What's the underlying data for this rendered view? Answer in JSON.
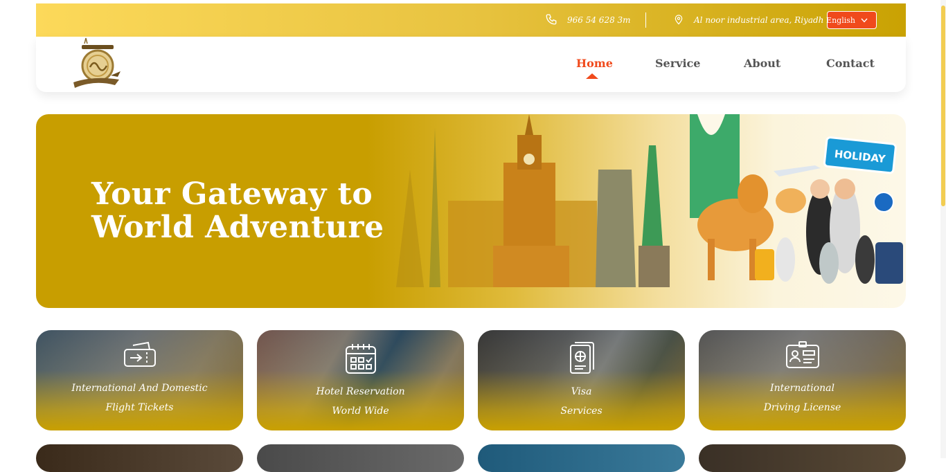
{
  "topbar": {
    "phone": "966 54 628 3m",
    "address": "Al noor industrial area, Riyadh",
    "language": "English"
  },
  "nav": {
    "items": [
      {
        "label": "Home",
        "active": true
      },
      {
        "label": "Service",
        "active": false
      },
      {
        "label": "About",
        "active": false
      },
      {
        "label": "Contact",
        "active": false
      }
    ]
  },
  "hero": {
    "title_line1": "Your Gateway to",
    "title_line2": "World Adventure",
    "sign_text": "HOLIDAY"
  },
  "services": [
    {
      "line1": "International And Domestic",
      "line2": "Flight Tickets",
      "icon": "ticket-icon"
    },
    {
      "line1": "Hotel Reservation",
      "line2": "World Wide",
      "icon": "calendar-icon"
    },
    {
      "line1": "Visa",
      "line2": "Services",
      "icon": "passport-icon"
    },
    {
      "line1": "International",
      "line2": "Driving License",
      "icon": "id-card-icon"
    }
  ],
  "colors": {
    "accent": "#f04a1c",
    "gold": "#c89e00",
    "topbar_light": "#fcd95a"
  }
}
